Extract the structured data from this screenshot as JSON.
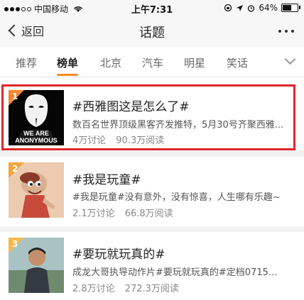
{
  "status_bar": {
    "carrier": "中国移动",
    "time": "上午7:31",
    "battery_text": "64%",
    "battery_level": 0.64
  },
  "nav": {
    "back_label": "返回",
    "title": "话题"
  },
  "tabs": [
    {
      "label": "推荐",
      "active": false
    },
    {
      "label": "榜单",
      "active": true
    },
    {
      "label": "北京",
      "active": false
    },
    {
      "label": "汽车",
      "active": false
    },
    {
      "label": "明星",
      "active": false
    },
    {
      "label": "笑话",
      "active": false
    }
  ],
  "topics": [
    {
      "rank": "1",
      "title": "#西雅图这是怎么了#",
      "description": "数百名世界顶级黑客齐发推特，5月30号齐聚西雅...",
      "discussions": "4万讨论",
      "reads": "90.3万阅读",
      "thumb_text": [
        "WE ARE",
        "ANONYMOUS"
      ],
      "rank_color": "#f5862d"
    },
    {
      "rank": "2",
      "title": "#我是玩童#",
      "description": "#我是玩童#没有意外，没有惊喜，人生哪有乐趣~",
      "discussions": "2.1万讨论",
      "reads": "66.8万阅读",
      "rank_color": "#f5a33b"
    },
    {
      "rank": "3",
      "title": "#要玩就玩真的#",
      "description": "成龙大哥执导动作片#要玩就玩真的#定档0715爆...",
      "discussions": "2.8万讨论",
      "reads": "272.3万阅读",
      "rank_color": "#f7b84c"
    }
  ],
  "colors": {
    "accent": "#f58c1f",
    "highlight_border": "#e0262a"
  }
}
